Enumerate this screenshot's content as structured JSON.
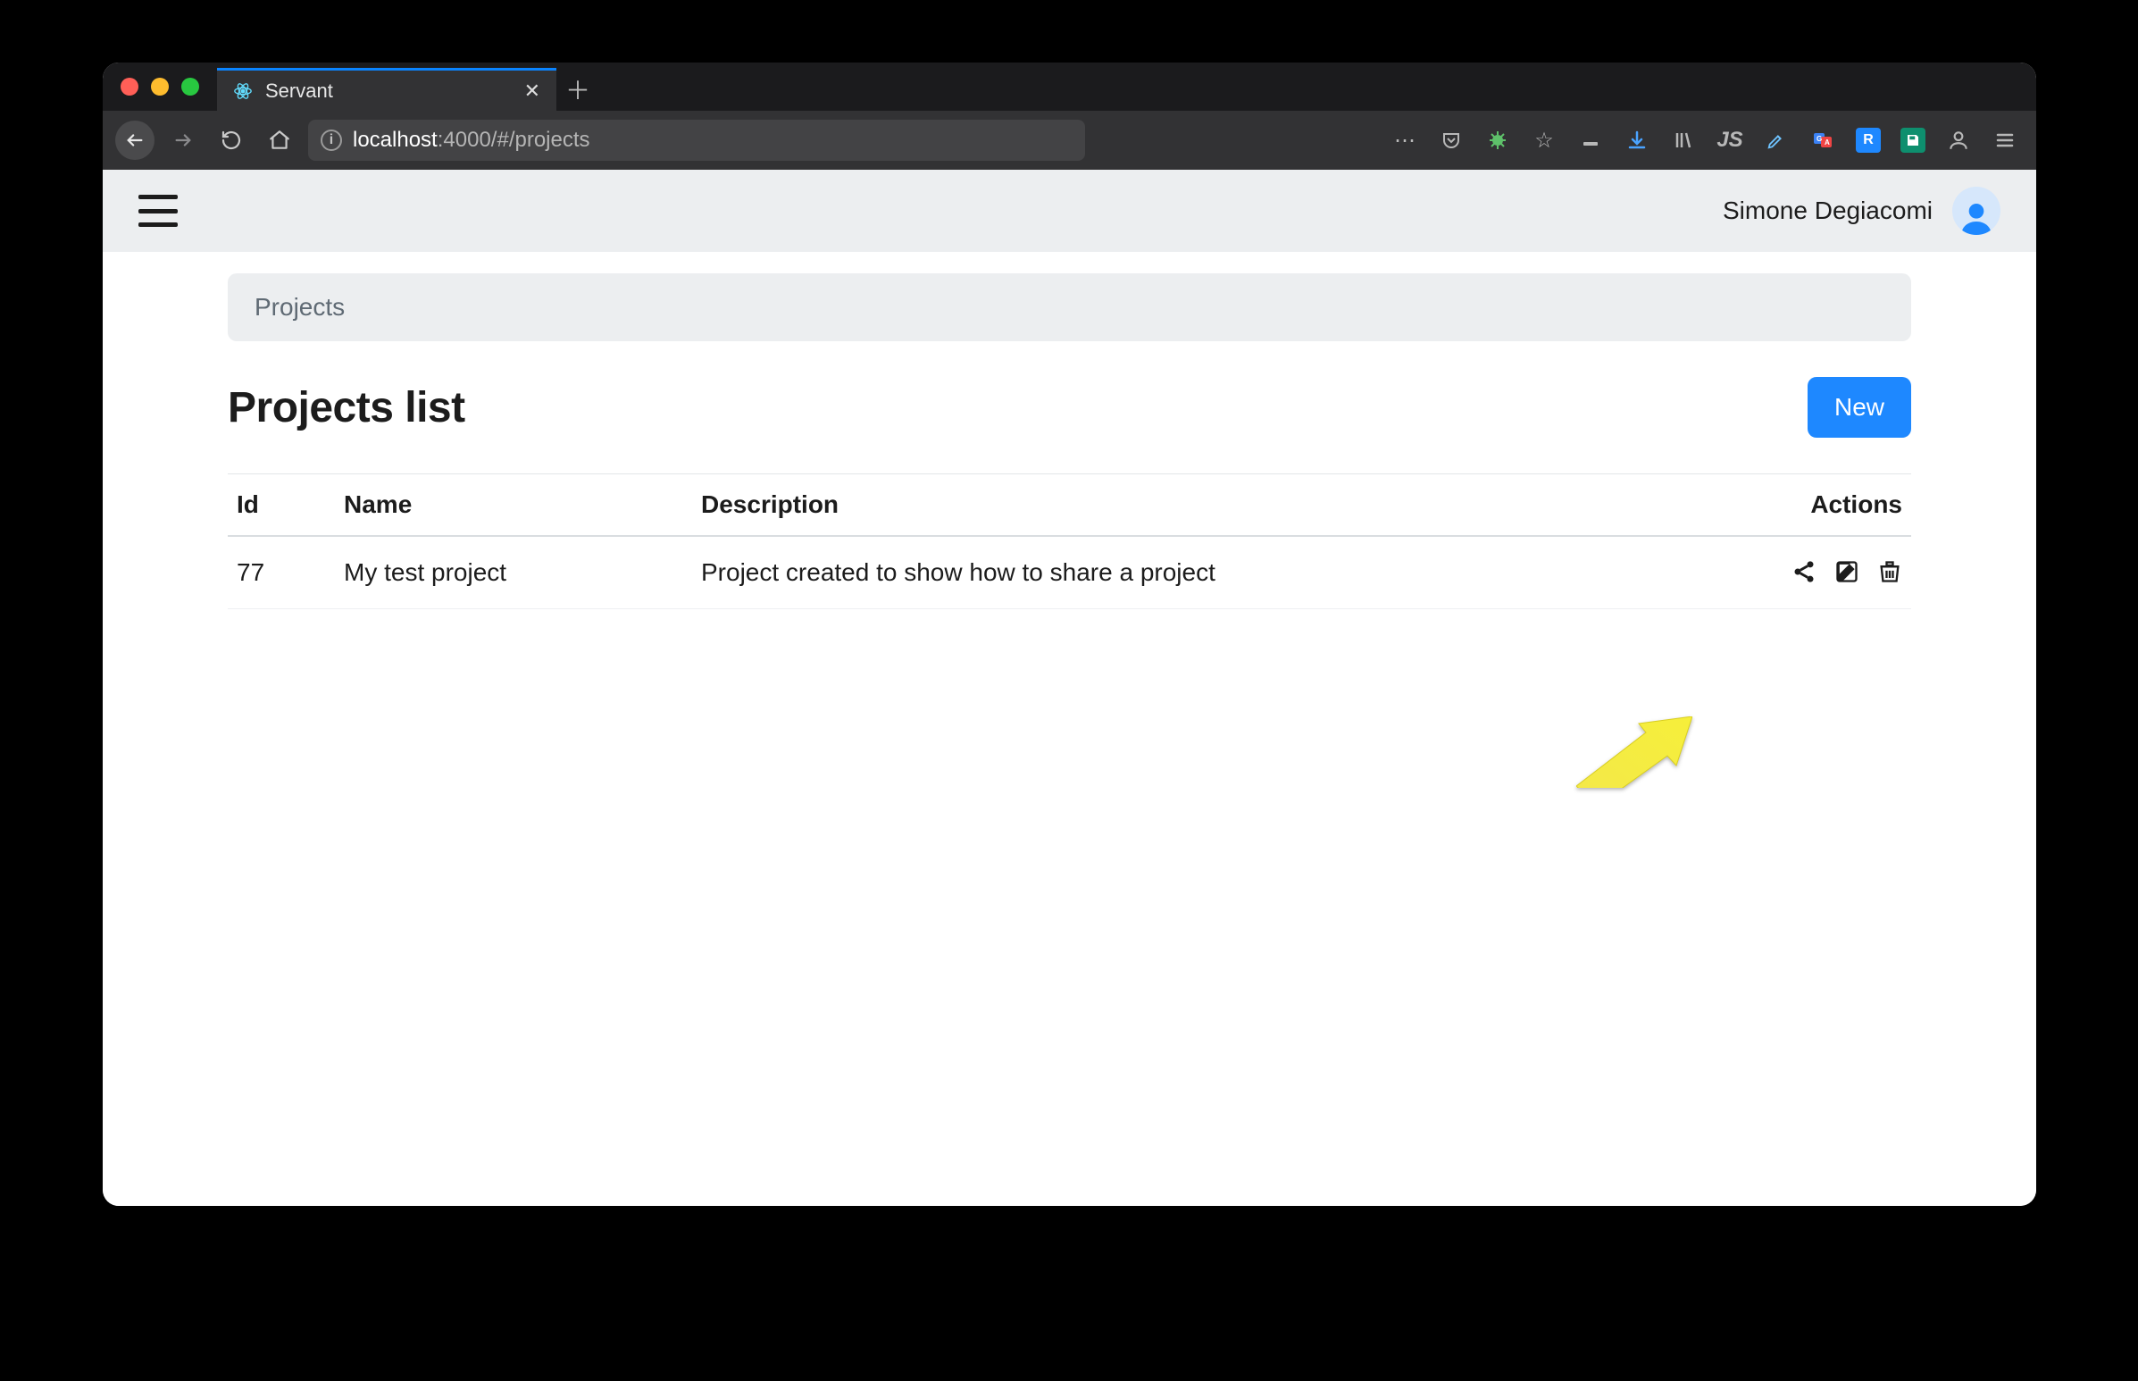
{
  "browser": {
    "tab_title": "Servant",
    "url_host": "localhost",
    "url_port": ":4000",
    "url_path": "/#/projects"
  },
  "header": {
    "user_name": "Simone Degiacomi"
  },
  "breadcrumb": {
    "current": "Projects"
  },
  "page": {
    "title": "Projects list",
    "new_button": "New"
  },
  "table": {
    "headers": {
      "id": "Id",
      "name": "Name",
      "description": "Description",
      "actions": "Actions"
    },
    "rows": [
      {
        "id": "77",
        "name": "My test project",
        "description": "Project created to show how to share a project"
      }
    ]
  }
}
